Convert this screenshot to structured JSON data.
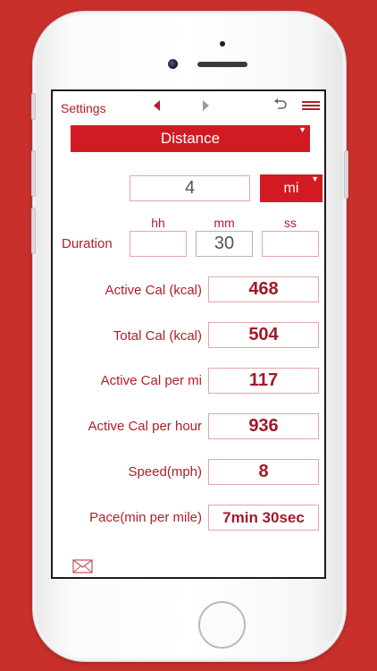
{
  "header": {
    "settings_label": "Settings",
    "prev_icon": "triangle-left-icon",
    "next_icon": "triangle-right-icon",
    "undo_icon": "undo-icon",
    "menu_icon": "hamburger-menu-icon"
  },
  "mode_select": {
    "value": "Distance"
  },
  "distance": {
    "value": "4",
    "unit": "mi"
  },
  "duration": {
    "label": "Duration",
    "headers": {
      "hh": "hh",
      "mm": "mm",
      "ss": "ss"
    },
    "values": {
      "hh": "",
      "mm": "30",
      "ss": ""
    }
  },
  "results": [
    {
      "label": "Active Cal (kcal)",
      "value": "468"
    },
    {
      "label": "Total Cal (kcal)",
      "value": "504"
    },
    {
      "label": "Active Cal per mi",
      "value": "117"
    },
    {
      "label": "Active Cal per hour",
      "value": "936"
    },
    {
      "label": "Speed(mph)",
      "value": "8"
    },
    {
      "label": "Pace(min per mile)",
      "value": "7min 30sec"
    }
  ],
  "footer": {
    "mail_icon": "envelope-icon"
  },
  "colors": {
    "background": "#c9302c",
    "accent": "#d21a22",
    "text": "#b01f28"
  }
}
